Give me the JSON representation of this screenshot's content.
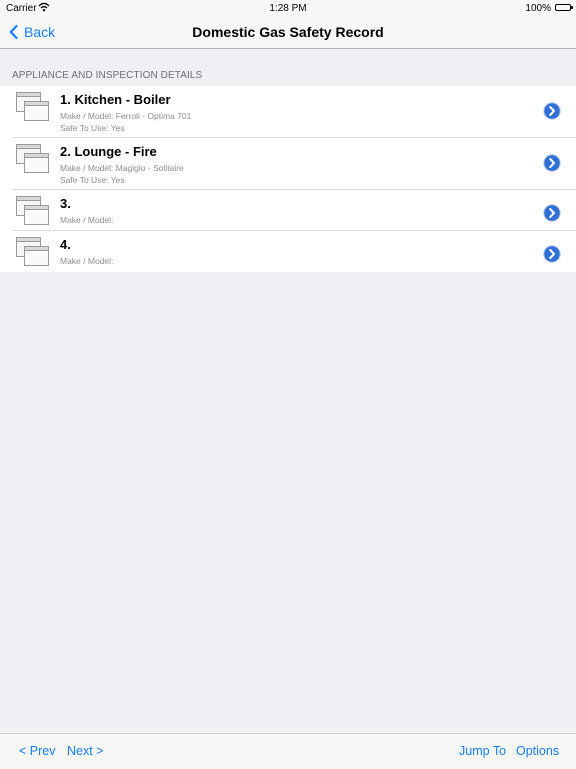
{
  "status_bar": {
    "carrier": "Carrier",
    "time": "1:28 PM",
    "battery": "100%"
  },
  "nav": {
    "back_label": "Back",
    "title": "Domestic Gas Safety Record"
  },
  "section": {
    "header": "APPLIANCE AND INSPECTION DETAILS"
  },
  "appliances": [
    {
      "title": "1. Kitchen - Boiler",
      "make_model": "Make / Model: Ferroli - Optima 701",
      "safe": "Safe To Use: Yes"
    },
    {
      "title": "2. Lounge - Fire",
      "make_model": "Make / Model: Magiglo - Solitaire",
      "safe": "Safe To Use: Yes"
    },
    {
      "title": "3.",
      "make_model": "Make / Model:"
    },
    {
      "title": "4.",
      "make_model": "Make / Model:"
    }
  ],
  "toolbar": {
    "prev": "<  Prev",
    "next": "Next  >",
    "jump_to": "Jump To",
    "options": "Options"
  },
  "colors": {
    "accent": "#157efb",
    "background": "#efeff4",
    "disclosure": "#2f6fd6"
  },
  "icons": {
    "wifi": "wifi-icon",
    "back": "chevron-left-icon",
    "row_thumb": "windows-stack-icon",
    "disclosure": "chevron-right-circle-icon"
  }
}
